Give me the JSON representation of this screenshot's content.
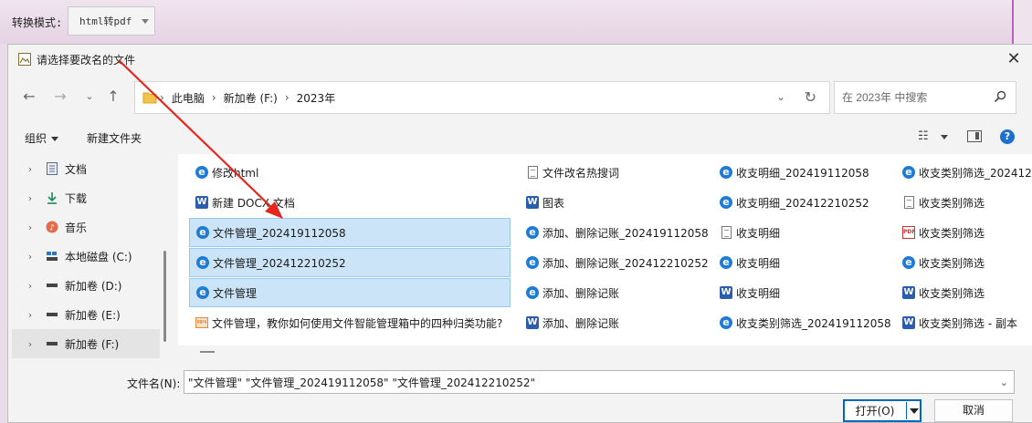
{
  "background_app": {
    "mode_label": "转换模式:",
    "mode_value": "html转pdf"
  },
  "dialog": {
    "title": "请选择要改名的文件",
    "address": {
      "crumbs": [
        "此电脑",
        "新加卷 (F:)",
        "2023年"
      ]
    },
    "search_placeholder": "在 2023年 中搜索",
    "toolbar": {
      "organize": "组织",
      "new_folder": "新建文件夹"
    },
    "sidebar": {
      "items": [
        {
          "label": "文档",
          "icon": "document-icon"
        },
        {
          "label": "下载",
          "icon": "download-icon"
        },
        {
          "label": "音乐",
          "icon": "music-icon"
        },
        {
          "label": "本地磁盘 (C:)",
          "icon": "drive-icon"
        },
        {
          "label": "新加卷 (D:)",
          "icon": "drive-icon"
        },
        {
          "label": "新加卷 (E:)",
          "icon": "drive-icon"
        },
        {
          "label": "新加卷 (F:)",
          "icon": "drive-icon",
          "selected": true
        }
      ]
    },
    "files": {
      "col1": [
        {
          "name": "修改html",
          "icon": "edge-icon",
          "selected": false
        },
        {
          "name": "新建 DOCX 文档",
          "icon": "word-icon",
          "selected": false
        },
        {
          "name": "文件管理_202419112058",
          "icon": "edge-icon",
          "selected": true
        },
        {
          "name": "文件管理_202412210252",
          "icon": "edge-icon",
          "selected": true
        },
        {
          "name": "文件管理",
          "icon": "edge-icon",
          "selected": true
        },
        {
          "name": "文件管理，教你如何使用文件智能管理箱中的四种归类功能?",
          "icon": "video-icon",
          "selected": false
        }
      ],
      "col2": [
        {
          "name": "文件改名热搜词",
          "icon": "text-icon"
        },
        {
          "name": "图表",
          "icon": "word-icon"
        },
        {
          "name": "添加、删除记账_202419112058",
          "icon": "edge-icon"
        },
        {
          "name": "添加、删除记账_202412210252",
          "icon": "edge-icon"
        },
        {
          "name": "添加、删除记账",
          "icon": "edge-icon"
        },
        {
          "name": "添加、删除记账",
          "icon": "word-icon"
        }
      ],
      "col3": [
        {
          "name": "收支明细_202419112058",
          "icon": "edge-icon"
        },
        {
          "name": "收支明细_202412210252",
          "icon": "edge-icon"
        },
        {
          "name": "收支明细",
          "icon": "text-icon"
        },
        {
          "name": "收支明细",
          "icon": "edge-icon"
        },
        {
          "name": "收支明细",
          "icon": "word-icon"
        },
        {
          "name": "收支类别筛选_202419112058",
          "icon": "edge-icon"
        }
      ],
      "col4": [
        {
          "name": "收支类别筛选_2024122",
          "icon": "edge-icon"
        },
        {
          "name": "收支类别筛选",
          "icon": "text-icon"
        },
        {
          "name": "收支类别筛选",
          "icon": "pdf-icon"
        },
        {
          "name": "收支类别筛选",
          "icon": "edge-icon"
        },
        {
          "name": "收支类别筛选",
          "icon": "word-icon"
        },
        {
          "name": "收支类别筛选 - 副本",
          "icon": "word-icon"
        }
      ]
    },
    "filename_label": "文件名(N):",
    "filename_value": "\"文件管理\" \"文件管理_202419112058\" \"文件管理_202412210252\"",
    "open_button": "打开(O)",
    "cancel_button": "取消"
  }
}
